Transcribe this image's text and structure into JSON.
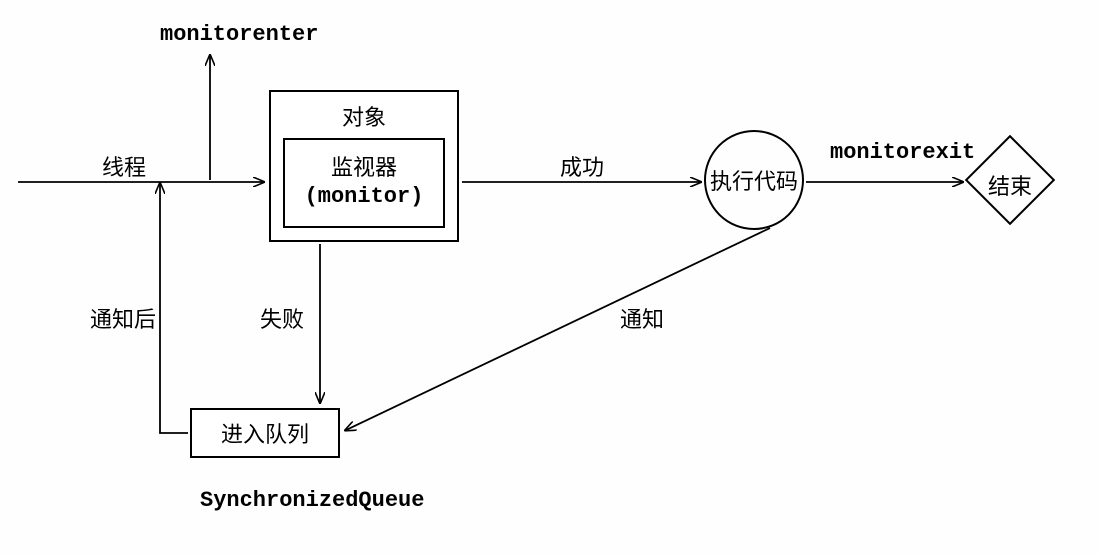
{
  "labels": {
    "monitorenter": "monitorenter",
    "monitorexit": "monitorexit",
    "thread": "线程",
    "object": "对象",
    "monitor_line1": "监视器",
    "monitor_line2": "(monitor)",
    "success": "成功",
    "execute_code": "执行代码",
    "end": "结束",
    "fail": "失败",
    "after_notify": "通知后",
    "enter_queue": "进入队列",
    "sync_queue": "SynchronizedQueue",
    "notify": "通知"
  }
}
